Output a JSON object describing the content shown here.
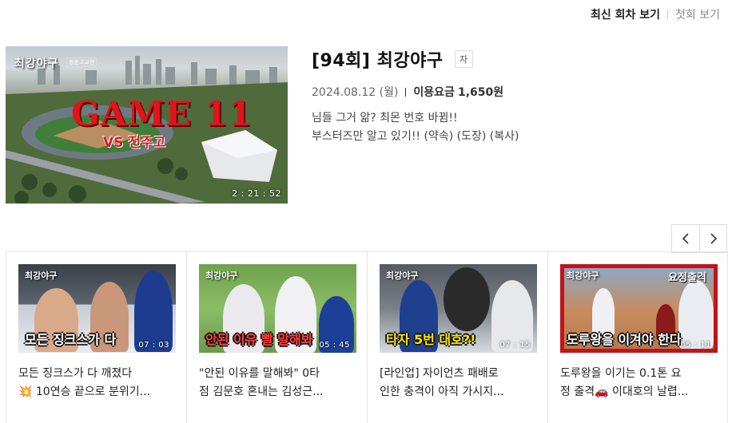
{
  "top_links": {
    "latest": "최신 회차 보기",
    "first": "첫회 보기"
  },
  "episode": {
    "title": "[94회] 최강야구",
    "subtitle_badge": "자",
    "date": "2024.08.12 (월)",
    "price_label": "이용요금",
    "price": "1,650원",
    "description_line1": "님들 그거 앎? 최몬 번호 바뀜!!",
    "description_line2": "부스터즈만 알고 있기!! (약속) (도장) (복사)",
    "thumb": {
      "logo": "최강야구",
      "logo_sub": "청춘고교전",
      "game_text": "GAME 11",
      "vs_text": "VS 전주고",
      "duration": "2 : 21 : 52"
    }
  },
  "carousel": {
    "prev_icon": "chevron-left-icon",
    "next_icon": "chevron-right-icon",
    "cards": [
      {
        "logo": "최강야구",
        "caption": "모든 징크스가 다",
        "duration": "07 : 03",
        "title_line1": "모든 징크스가 다 깨졌다",
        "title_line2": "💥 10연승 끝으로 분위기..."
      },
      {
        "logo": "최강야구",
        "caption": "안된 이유 빨 말해봐",
        "duration": "05 : 45",
        "title_line1": "\"안된 이유를 말해봐\" 0타",
        "title_line2": "점 김문호 혼내는 김성근..."
      },
      {
        "logo": "최강야구",
        "caption": "타자 5번 대호?!",
        "duration": "07 : 15",
        "title_line1": "[라인업] 자이언츠 패배로",
        "title_line2": "인한 충격이 아직 가시지..."
      },
      {
        "logo": "최강야구",
        "caption": "도루왕을 이겨야 한다",
        "badge": "요정출격",
        "duration": "05 : 11",
        "title_line1": "도루왕을 이기는 0.1톤 요",
        "title_line2": "정 출격🚗 이대호의 날렵..."
      }
    ]
  }
}
